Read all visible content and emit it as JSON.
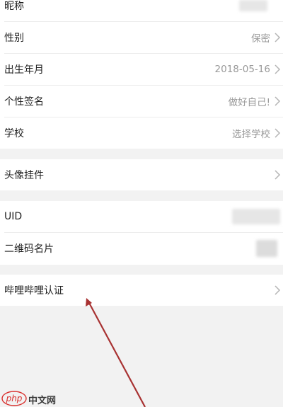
{
  "profile_rows": {
    "nickname": {
      "label": "昵称"
    },
    "gender": {
      "label": "性别",
      "value": "保密"
    },
    "birthday": {
      "label": "出生年月",
      "value": "2018-05-16"
    },
    "signature": {
      "label": "个性签名",
      "value": "做好自己!"
    },
    "school": {
      "label": "学校",
      "value": "选择学校"
    }
  },
  "pendant_row": {
    "label": "头像挂件"
  },
  "id_rows": {
    "uid": {
      "label": "UID"
    },
    "qrcode": {
      "label": "二维码名片"
    }
  },
  "verify_row": {
    "label": "哔哩哔哩认证"
  },
  "watermark": {
    "text": "中文网",
    "logo": "php"
  },
  "colors": {
    "background": "#f2f2f2",
    "row_bg": "#ffffff",
    "value_text": "#9a9a9a",
    "arrow": "#a83232",
    "watermark_logo": "#d9302e"
  }
}
